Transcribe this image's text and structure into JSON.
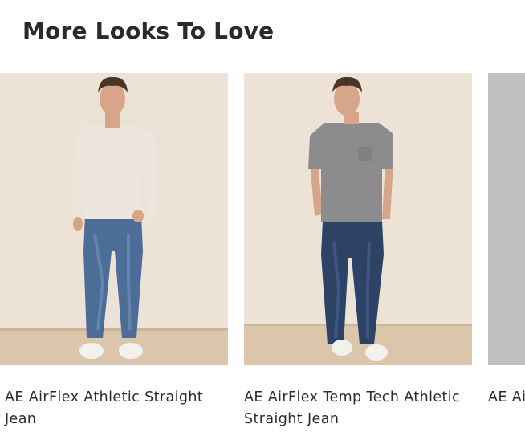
{
  "section": {
    "title": "More Looks To Love"
  },
  "products": [
    {
      "name": "AE AirFlex Athletic Straight Jean",
      "top_color": "#ece6de",
      "jean_color": "#4b6d97"
    },
    {
      "name": "AE AirFlex Temp Tech Athletic Straight Jean",
      "top_color": "#8c8c8e",
      "jean_color": "#2c4365"
    },
    {
      "name": "AE AirFlex Temp Tech Athletic Straight Jean"
    }
  ],
  "colors": {
    "backdrop": "#ece3d6",
    "floor": "#dcc6ab",
    "skin": "#d8a48a",
    "hair": "#4a3426",
    "sneaker": "#f3f1ec"
  }
}
